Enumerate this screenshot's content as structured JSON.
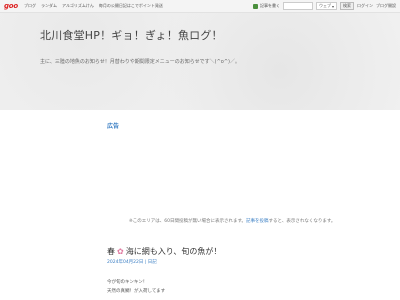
{
  "topbar": {
    "logo": "goo",
    "nav_items": [
      "ブログ",
      "ランダム",
      "アルゴリズムけん",
      "毎月の公開日記はこでポイント発送"
    ],
    "share_label": "記事を書く",
    "search_select": "ウェブ",
    "search_button": "検索",
    "login_label": "ログイン",
    "blog_start_label": "ブログ開設"
  },
  "header": {
    "title": "北川食堂HP！ギョ！ぎょ！魚ログ！",
    "description": "主に、三陸の地魚のお知らせ！月替わりや期間限定メニューのお知らせです＼(^o^)／。"
  },
  "ad": {
    "label": "広告",
    "notice_pre": "※このエリアは、60日間投稿が無い場合に表示されます。",
    "notice_link": "記事を投稿",
    "notice_post": "すると、表示されなくなります。"
  },
  "post": {
    "title_pre": "春",
    "title": "海に網も入り、旬の魚が！",
    "date": "2024年04月22日 | 日記",
    "body_lines": [
      "今が旬のキンキン！",
      "天然の真鯛！が入荷してます"
    ]
  },
  "colors": {
    "link": "#3b7fc4",
    "logo_red": "#dd2222",
    "header_bg": "#f0f0f0"
  }
}
